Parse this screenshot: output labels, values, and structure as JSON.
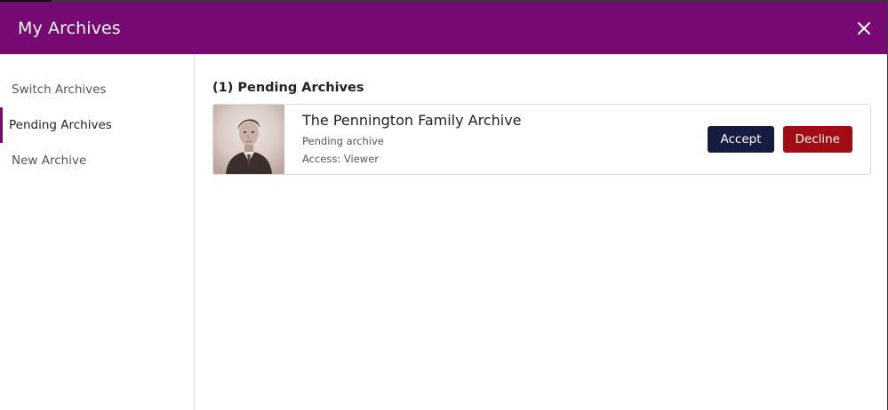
{
  "header": {
    "title": "My Archives",
    "close_icon": "close-icon"
  },
  "sidebar": {
    "items": [
      {
        "label": "Switch Archives",
        "active": false
      },
      {
        "label": "Pending Archives",
        "active": true
      },
      {
        "label": "New Archive",
        "active": false
      }
    ]
  },
  "main": {
    "section_title": "(1) Pending Archives",
    "archives": [
      {
        "name": "The Pennington Family Archive",
        "status": "Pending archive",
        "access": "Access: Viewer",
        "thumbnail_icon": "archive-portrait-thumbnail",
        "accept_label": "Accept",
        "decline_label": "Decline"
      }
    ]
  },
  "colors": {
    "brand": "#760a72",
    "accept": "#151c40",
    "decline": "#a10d12"
  }
}
